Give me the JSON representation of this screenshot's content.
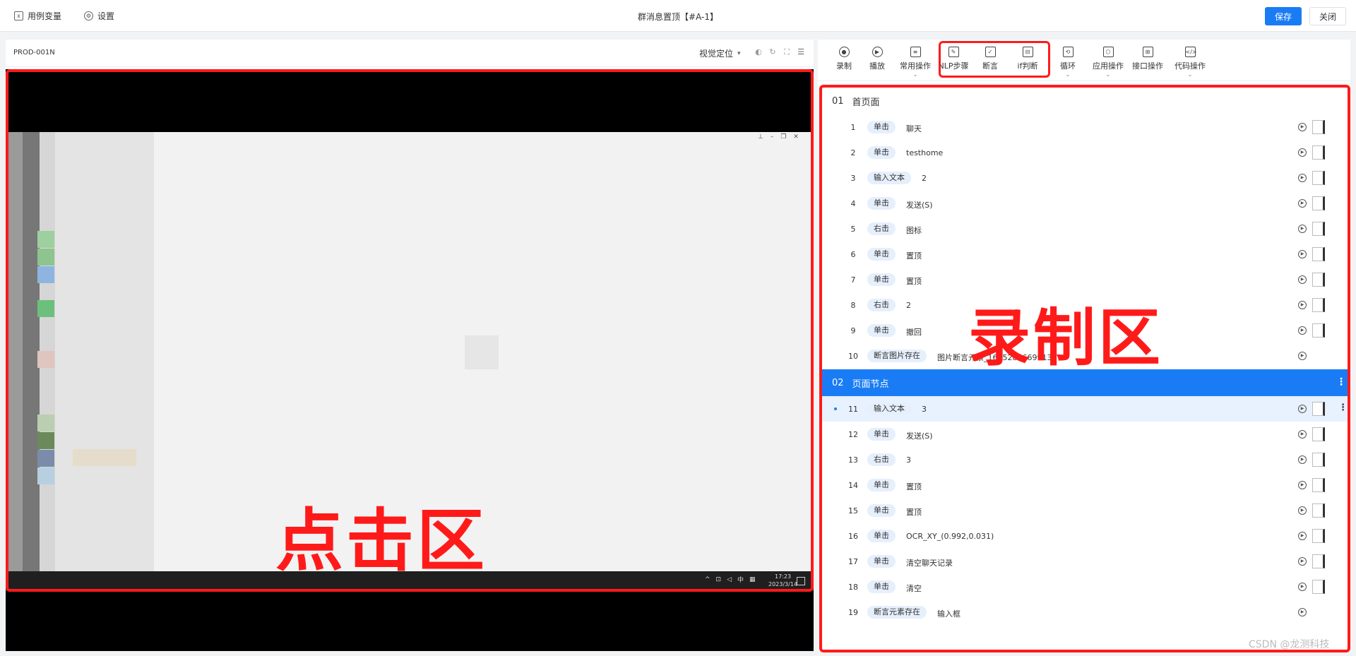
{
  "topbar": {
    "variables_label": "用例变量",
    "settings_label": "设置",
    "title": "群消息置顶【#A-1】",
    "save_label": "保存",
    "close_label": "关闭"
  },
  "device_panel": {
    "device_id": "PROD-001N",
    "visual_locate_label": "视觉定位",
    "taskbar_time": "17:23",
    "taskbar_date": "2023/3/14",
    "taskbar_ime": "中"
  },
  "toolbar": [
    {
      "label": "录制",
      "icon": "record-icon"
    },
    {
      "label": "播放",
      "icon": "play-icon"
    },
    {
      "label": "常用操作",
      "icon": "list-icon"
    },
    {
      "label": "NLP步骤",
      "icon": "nlp-icon"
    },
    {
      "label": "断言",
      "icon": "assert-icon"
    },
    {
      "label": "if判断",
      "icon": "if-icon"
    },
    {
      "label": "循环",
      "icon": "loop-icon"
    },
    {
      "label": "应用操作",
      "icon": "app-icon"
    },
    {
      "label": "接口操作",
      "icon": "api-icon"
    },
    {
      "label": "代码操作",
      "icon": "code-icon"
    }
  ],
  "groups": [
    {
      "num": "01",
      "name": "首页面"
    },
    {
      "num": "02",
      "name": "页面节点"
    }
  ],
  "steps": [
    {
      "num": "1",
      "action": "单击",
      "value": "聊天"
    },
    {
      "num": "2",
      "action": "单击",
      "value": "testhome"
    },
    {
      "num": "3",
      "action": "输入文本",
      "value": "2"
    },
    {
      "num": "4",
      "action": "单击",
      "value": "发送(S)"
    },
    {
      "num": "5",
      "action": "右击",
      "value": "图标"
    },
    {
      "num": "6",
      "action": "单击",
      "value": "置顶"
    },
    {
      "num": "7",
      "action": "单击",
      "value": "置顶"
    },
    {
      "num": "8",
      "action": "右击",
      "value": "2"
    },
    {
      "num": "9",
      "action": "单击",
      "value": "撤回"
    },
    {
      "num": "10",
      "action": "断言图片存在",
      "value": "图片断言元素_1665281669913"
    },
    {
      "num": "11",
      "action": "输入文本",
      "value": "3"
    },
    {
      "num": "12",
      "action": "单击",
      "value": "发送(S)"
    },
    {
      "num": "13",
      "action": "右击",
      "value": "3"
    },
    {
      "num": "14",
      "action": "单击",
      "value": "置顶"
    },
    {
      "num": "15",
      "action": "单击",
      "value": "置顶"
    },
    {
      "num": "16",
      "action": "单击",
      "value": "OCR_XY_(0.992,0.031)"
    },
    {
      "num": "17",
      "action": "单击",
      "value": "清空聊天记录"
    },
    {
      "num": "18",
      "action": "单击",
      "value": "清空"
    },
    {
      "num": "19",
      "action": "断言元素存在",
      "value": "输入框"
    }
  ],
  "annotations": {
    "click_area": "点击区",
    "record_area": "录制区"
  },
  "watermark": "CSDN @龙测科技",
  "colors": {
    "accent": "#1a7cf5",
    "annotation": "#ff1a1a"
  }
}
